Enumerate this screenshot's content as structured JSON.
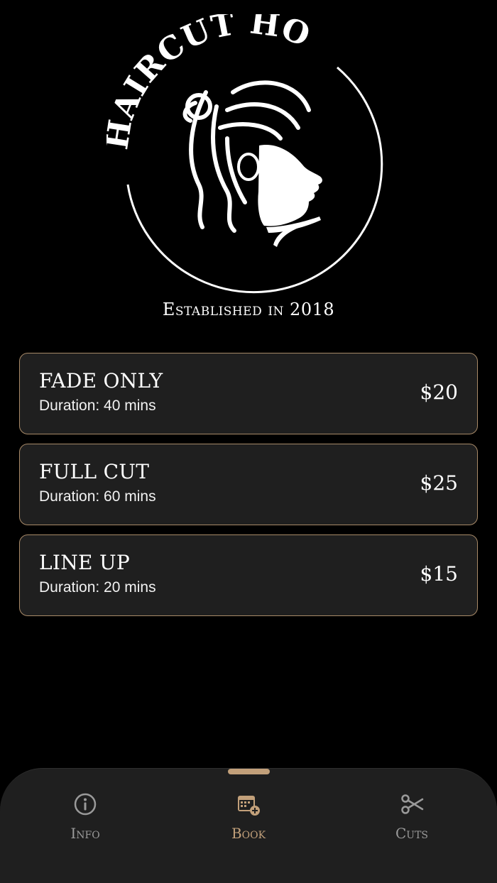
{
  "brand": {
    "logo_text": "HAIRCUT HOMIE",
    "tagline": "Established in 2018"
  },
  "services": [
    {
      "name": "FADE ONLY",
      "duration": "Duration: 40 mins",
      "price": "$20"
    },
    {
      "name": "FULL CUT",
      "duration": "Duration: 60 mins",
      "price": "$25"
    },
    {
      "name": "LINE UP",
      "duration": "Duration: 20 mins",
      "price": "$15"
    }
  ],
  "tabbar": {
    "active": "book",
    "tabs": [
      {
        "id": "info",
        "label": "Info",
        "icon": "info-circle-icon"
      },
      {
        "id": "book",
        "label": "Book",
        "icon": "calendar-add-icon"
      },
      {
        "id": "cuts",
        "label": "Cuts",
        "icon": "scissors-icon"
      }
    ]
  },
  "colors": {
    "background": "#000000",
    "card": "#1f1f1f",
    "accent": "#c2a07a",
    "card_border": "#a88a68",
    "inactive": "#9a9a9a"
  }
}
